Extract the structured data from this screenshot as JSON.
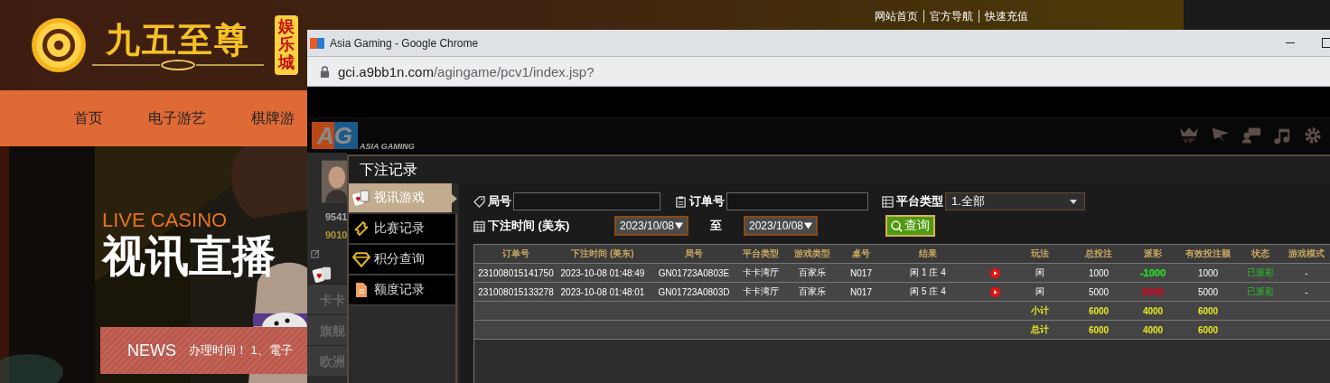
{
  "site": {
    "logo": {
      "name": "九五至尊",
      "badge": "娱乐城"
    },
    "top_links": [
      "网站首页",
      "官方导航",
      "快速充值"
    ],
    "nav": [
      "首页",
      "电子游艺",
      "棋牌游"
    ],
    "banner": {
      "subtitle": "LIVE CASINO",
      "title": "视讯直播"
    },
    "news": {
      "label": "NEWS",
      "text": "办理时间！ 1、電子"
    }
  },
  "browser": {
    "title": "Asia Gaming - Google Chrome",
    "url_host": "gci.a9bb1n.com",
    "url_path": "/agingame/pcv1/index.jsp?"
  },
  "game": {
    "logo": "AG",
    "tagline": "ASIA GAMING",
    "vip_label": "VIP",
    "stats": [
      "9541",
      "9010"
    ],
    "lobby": [
      "卡卡",
      "旗舰",
      "欧洲"
    ]
  },
  "modal": {
    "title": "下注记录",
    "menu": [
      {
        "label": "视讯游戏",
        "selected": true,
        "kind": "cards"
      },
      {
        "label": "比赛记录",
        "selected": false,
        "kind": "ticket"
      },
      {
        "label": "积分查询",
        "selected": false,
        "kind": "diamond"
      },
      {
        "label": "额度记录",
        "selected": false,
        "kind": "document"
      }
    ],
    "filters": {
      "round_label": "局号",
      "order_label": "订单号",
      "platform_label": "平台类型",
      "platform_value": "1.全部",
      "time_label": "下注时间 (美东)",
      "date_from": "2023/10/08",
      "to_label": "至",
      "date_to": "2023/10/08",
      "search": "查询"
    },
    "table": {
      "columns": [
        "订单号",
        "下注时间 (美东)",
        "局号",
        "平台类型",
        "游戏类型",
        "桌号",
        "结果",
        "玩法",
        "总投注",
        "派彩",
        "有效投注额",
        "状态",
        "游戏模式"
      ],
      "rows": [
        {
          "order": "231008015141750",
          "time": "2023-10-08 01:48:49",
          "round": "GN01723A0803E",
          "platform": "卡卡湾厅",
          "game": "百家乐",
          "table": "N017",
          "result": "闲 1 庄 4",
          "play": "闲",
          "bet": "1000",
          "payout": "-1000",
          "color": "#2ecc2e",
          "valid": "1000",
          "status": "已派彩",
          "mode": "-"
        },
        {
          "order": "231008015133278",
          "time": "2023-10-08 01:48:01",
          "round": "GN01723A0803D",
          "platform": "卡卡湾厅",
          "game": "百家乐",
          "table": "N017",
          "result": "闲 5 庄 4",
          "play": "闲",
          "bet": "5000",
          "payout": "5000",
          "color": "#c0102a",
          "valid": "5000",
          "status": "已派彩",
          "mode": "-"
        }
      ],
      "totals": [
        {
          "label": "小计",
          "bet": "6000",
          "payout": "4000",
          "valid": "6000"
        },
        {
          "label": "总计",
          "bet": "6000",
          "payout": "4000",
          "valid": "6000"
        }
      ]
    }
  }
}
